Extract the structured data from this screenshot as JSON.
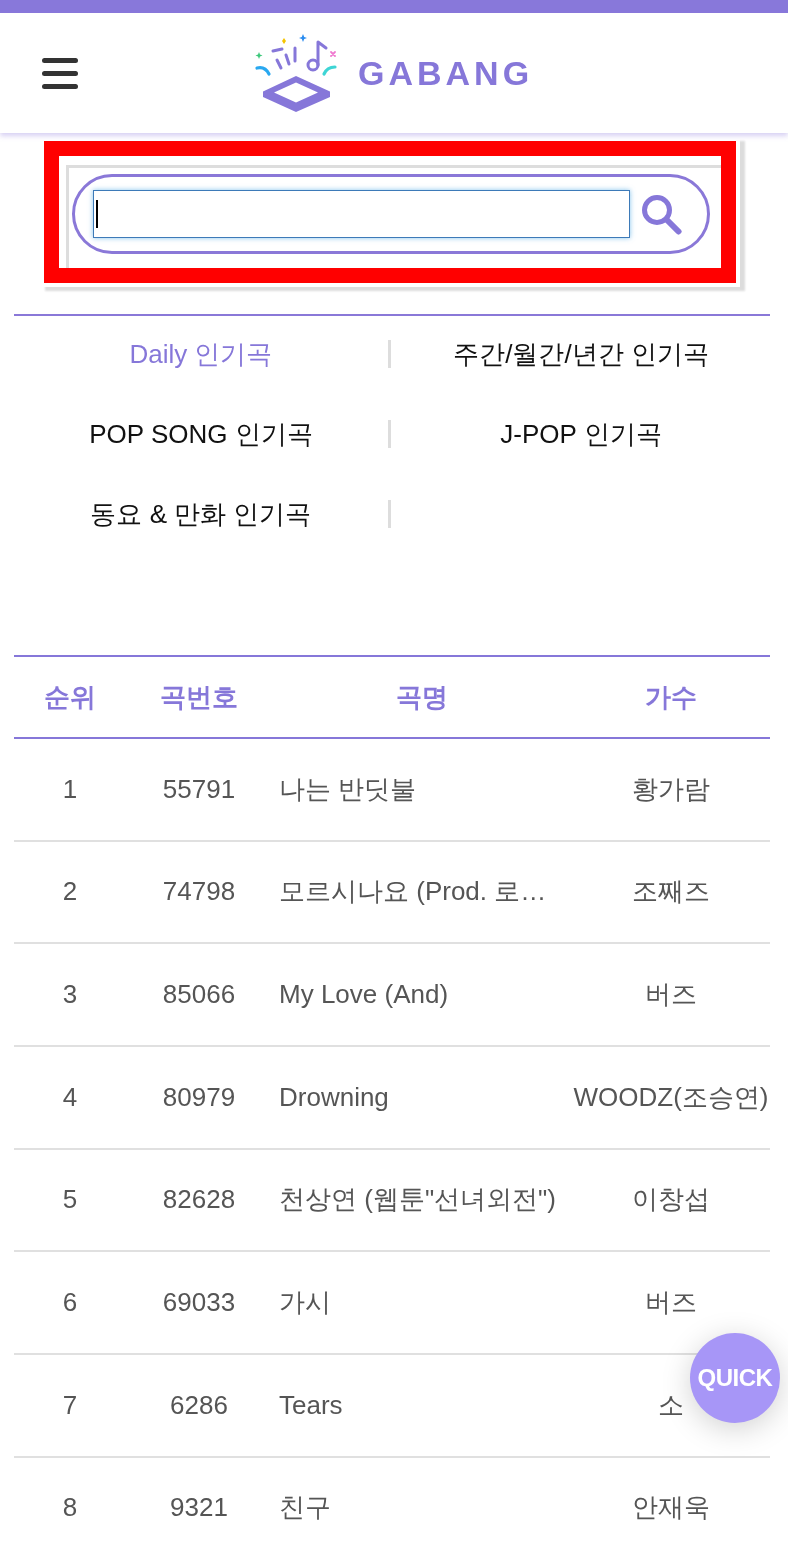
{
  "header": {
    "logo_text": "GABANG"
  },
  "search": {
    "focused": true,
    "highlighted": true
  },
  "categories": [
    {
      "label": "Daily 인기곡",
      "selected": true
    },
    {
      "label": "주간/월간/년간 인기곡",
      "selected": false
    },
    {
      "label": "POP SONG 인기곡",
      "selected": false
    },
    {
      "label": "J-POP 인기곡",
      "selected": false
    },
    {
      "label": "동요 & 만화 인기곡",
      "selected": false
    }
  ],
  "table": {
    "columns": [
      "순위",
      "곡번호",
      "곡명",
      "가수"
    ],
    "rows": [
      [
        "1",
        "55791",
        "나는 반딧불",
        "황가람"
      ],
      [
        "2",
        "74798",
        "모르시나요 (Prod. 로…",
        "조째즈"
      ],
      [
        "3",
        "85066",
        "My Love (And)",
        "버즈"
      ],
      [
        "4",
        "80979",
        "Drowning",
        "WOODZ(조승연)"
      ],
      [
        "5",
        "82628",
        "천상연 (웹툰\"선녀외전\")",
        "이창섭"
      ],
      [
        "6",
        "69033",
        "가시",
        "버즈"
      ],
      [
        "7",
        "6286",
        "Tears",
        "소"
      ],
      [
        "8",
        "9321",
        "친구",
        "안재욱"
      ]
    ]
  },
  "quick_button": {
    "label": "QUICK"
  }
}
